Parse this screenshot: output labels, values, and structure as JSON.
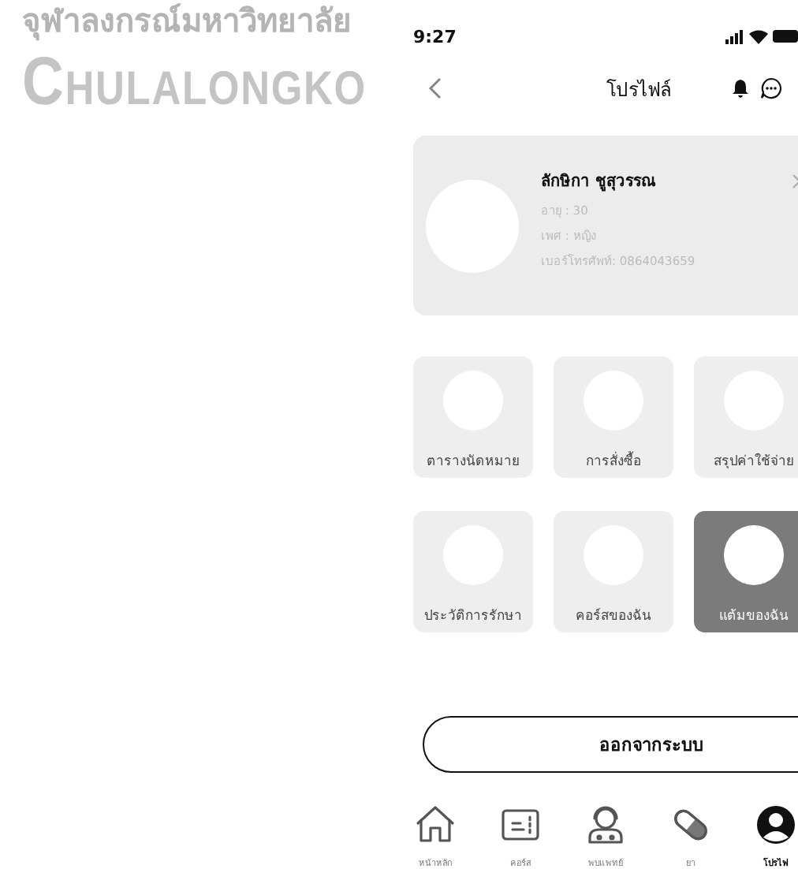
{
  "background_text": {
    "thai": "จุฬาลงกรณ์มหาวิทยาลัย",
    "latin": "CHULALONGKO"
  },
  "status_bar": {
    "time": "9:27"
  },
  "header": {
    "title": "โปรไฟล์"
  },
  "profile": {
    "name": "ลักษิกา  ชูสุวรรณ",
    "details": [
      "อายุ : 30",
      "เพศ : หญิง",
      "เบอร์โทรศัพท์: 0864043659"
    ]
  },
  "menu": [
    {
      "label": "ตารางนัดหมาย",
      "selected": false
    },
    {
      "label": "การสั่งซื้อ",
      "selected": false
    },
    {
      "label": "สรุปค่าใช้จ่าย",
      "selected": false
    },
    {
      "label": "ประวัติการรักษา",
      "selected": false
    },
    {
      "label": "คอร์สของฉัน",
      "selected": false
    },
    {
      "label": "แต้มของฉัน",
      "selected": true
    }
  ],
  "logout_button": "ออกจากระบบ",
  "nav": [
    {
      "kind": "home",
      "label": "หน้าหลัก",
      "selected": false
    },
    {
      "kind": "course",
      "label": "คอร์ส",
      "selected": false
    },
    {
      "kind": "doctor",
      "label": "พบแพทย์",
      "selected": false
    },
    {
      "kind": "medicine",
      "label": "ยา",
      "selected": false
    },
    {
      "kind": "profile",
      "label": "โปรไฟ",
      "selected": true
    }
  ]
}
